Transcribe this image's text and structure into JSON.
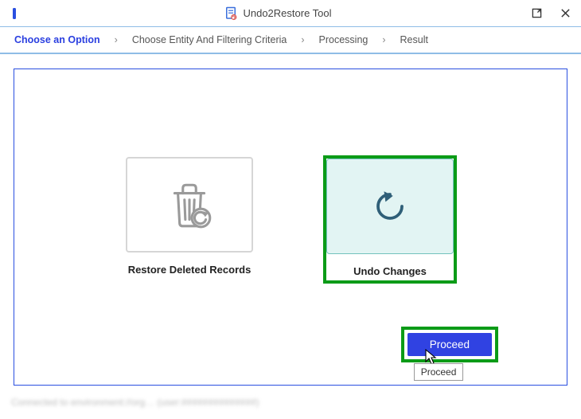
{
  "window": {
    "title": "Undo2Restore Tool"
  },
  "breadcrumbs": {
    "step1": "Choose an Option",
    "step2": "Choose Entity And Filtering Criteria",
    "step3": "Processing",
    "step4": "Result"
  },
  "options": {
    "restore": {
      "label": "Restore Deleted Records"
    },
    "undo": {
      "label": "Undo Changes"
    }
  },
  "actions": {
    "proceed_label": "Proceed",
    "proceed_tooltip": "Proceed"
  },
  "status": {
    "text": "Connected to environment://org… (user:##############)"
  }
}
